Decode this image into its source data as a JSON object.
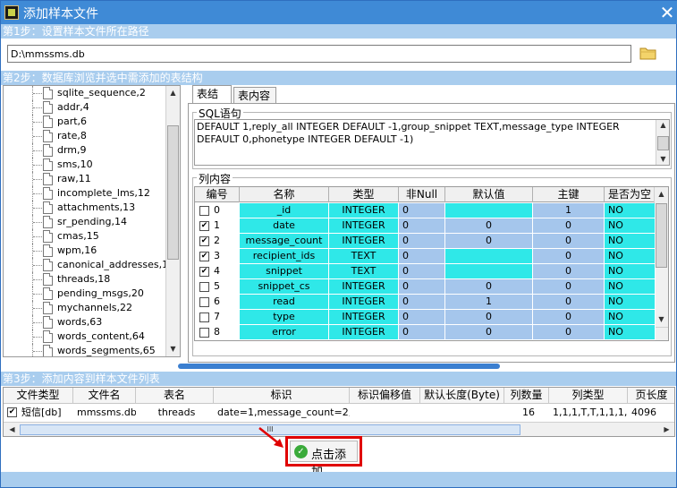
{
  "window": {
    "title": "添加样本文件"
  },
  "step1": {
    "label": "第1步：设置样本文件所在路径",
    "path_value": "D:\\mmssms.db"
  },
  "step2": {
    "label": "第2步：数据库浏览并选中需添加的表结构",
    "tree_items": [
      "sqlite_sequence,2",
      "addr,4",
      "part,6",
      "rate,8",
      "drm,9",
      "sms,10",
      "raw,11",
      "incomplete_lms,12",
      "attachments,13",
      "sr_pending,14",
      "cmas,15",
      "wpm,16",
      "canonical_addresses,17",
      "threads,18",
      "pending_msgs,20",
      "mychannels,22",
      "words,63",
      "words_content,64",
      "words_segments,65"
    ],
    "tabs": [
      "表结构",
      "表内容"
    ],
    "sql_group_label": "SQL语句",
    "sql_text": "DEFAULT 1,reply_all INTEGER DEFAULT -1,group_snippet TEXT,message_type INTEGER DEFAULT 0,phonetype INTEGER DEFAULT -1)",
    "columns_group_label": "列内容",
    "grid_headers": [
      "编号",
      "名称",
      "类型",
      "非Null",
      "默认值",
      "主键",
      "是否为空"
    ],
    "grid_rows": [
      {
        "checked": false,
        "num": "0",
        "name": "_id",
        "type": "INTEGER",
        "notnull": "0",
        "default": "",
        "pk": "1",
        "nullable": "NO"
      },
      {
        "checked": true,
        "num": "1",
        "name": "date",
        "type": "INTEGER",
        "notnull": "0",
        "default": "0",
        "pk": "0",
        "nullable": "NO"
      },
      {
        "checked": true,
        "num": "2",
        "name": "message_count",
        "type": "INTEGER",
        "notnull": "0",
        "default": "0",
        "pk": "0",
        "nullable": "NO"
      },
      {
        "checked": true,
        "num": "3",
        "name": "recipient_ids",
        "type": "TEXT",
        "notnull": "0",
        "default": "",
        "pk": "0",
        "nullable": "NO"
      },
      {
        "checked": true,
        "num": "4",
        "name": "snippet",
        "type": "TEXT",
        "notnull": "0",
        "default": "",
        "pk": "0",
        "nullable": "NO"
      },
      {
        "checked": false,
        "num": "5",
        "name": "snippet_cs",
        "type": "INTEGER",
        "notnull": "0",
        "default": "0",
        "pk": "0",
        "nullable": "NO"
      },
      {
        "checked": false,
        "num": "6",
        "name": "read",
        "type": "INTEGER",
        "notnull": "0",
        "default": "1",
        "pk": "0",
        "nullable": "NO"
      },
      {
        "checked": false,
        "num": "7",
        "name": "type",
        "type": "INTEGER",
        "notnull": "0",
        "default": "0",
        "pk": "0",
        "nullable": "NO"
      },
      {
        "checked": false,
        "num": "8",
        "name": "error",
        "type": "INTEGER",
        "notnull": "0",
        "default": "0",
        "pk": "0",
        "nullable": "NO"
      }
    ]
  },
  "step3": {
    "label": "第3步：添加内容到样本文件列表",
    "list_headers": [
      "文件类型",
      "文件名",
      "表名",
      "标识",
      "标识偏移值",
      "默认长度(Byte)",
      "列数量",
      "列类型",
      "页长度"
    ],
    "list_row": {
      "checked": true,
      "file_type": "短信[db]",
      "file_name": "mmssms.db",
      "table": "threads",
      "identifier": "date=1,message_count=2,r...",
      "offset": "",
      "default_len": "",
      "col_count": "16",
      "col_types": "1,1,1,T,T,1,1,1,...",
      "page_len": "4096"
    },
    "add_button": "点击添加"
  },
  "scroll_grip": "III",
  "colors": {
    "accent": "#3f8ad6",
    "cyan": "#2fe8e8",
    "blue_cell": "#a5c6ec",
    "highlight": "#e00000"
  }
}
